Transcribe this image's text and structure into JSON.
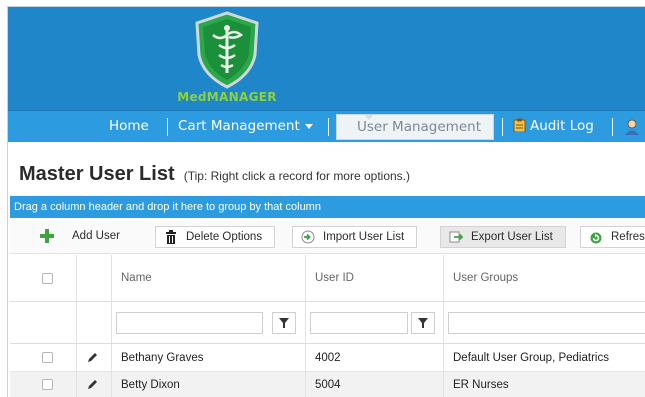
{
  "header": {
    "brand_text": "MedMANAGER",
    "colors": {
      "banner": "#1f87c9",
      "nav": "#2d9be0",
      "brand": "#8cd23a",
      "shield": "#1f9d3a"
    }
  },
  "nav": {
    "items": [
      {
        "label": "Home"
      },
      {
        "label": "Cart Management"
      },
      {
        "label": "User Management"
      },
      {
        "label": "Audit Log"
      }
    ]
  },
  "page": {
    "title": "Master User List",
    "tip": "(Tip: Right click a record for more options.)"
  },
  "grid": {
    "group_hint": "Drag a column header and drop it here to group by that column",
    "toolbar": {
      "add": "Add User",
      "delete": "Delete Options",
      "import": "Import User List",
      "export": "Export User List",
      "refresh": "Refres"
    },
    "columns": [
      "Name",
      "User ID",
      "User Groups"
    ],
    "rows": [
      {
        "name": "Bethany Graves",
        "user_id": "4002",
        "groups": "Default User Group, Pediatrics"
      },
      {
        "name": "Betty Dixon",
        "user_id": "5004",
        "groups": "ER Nurses"
      }
    ]
  }
}
